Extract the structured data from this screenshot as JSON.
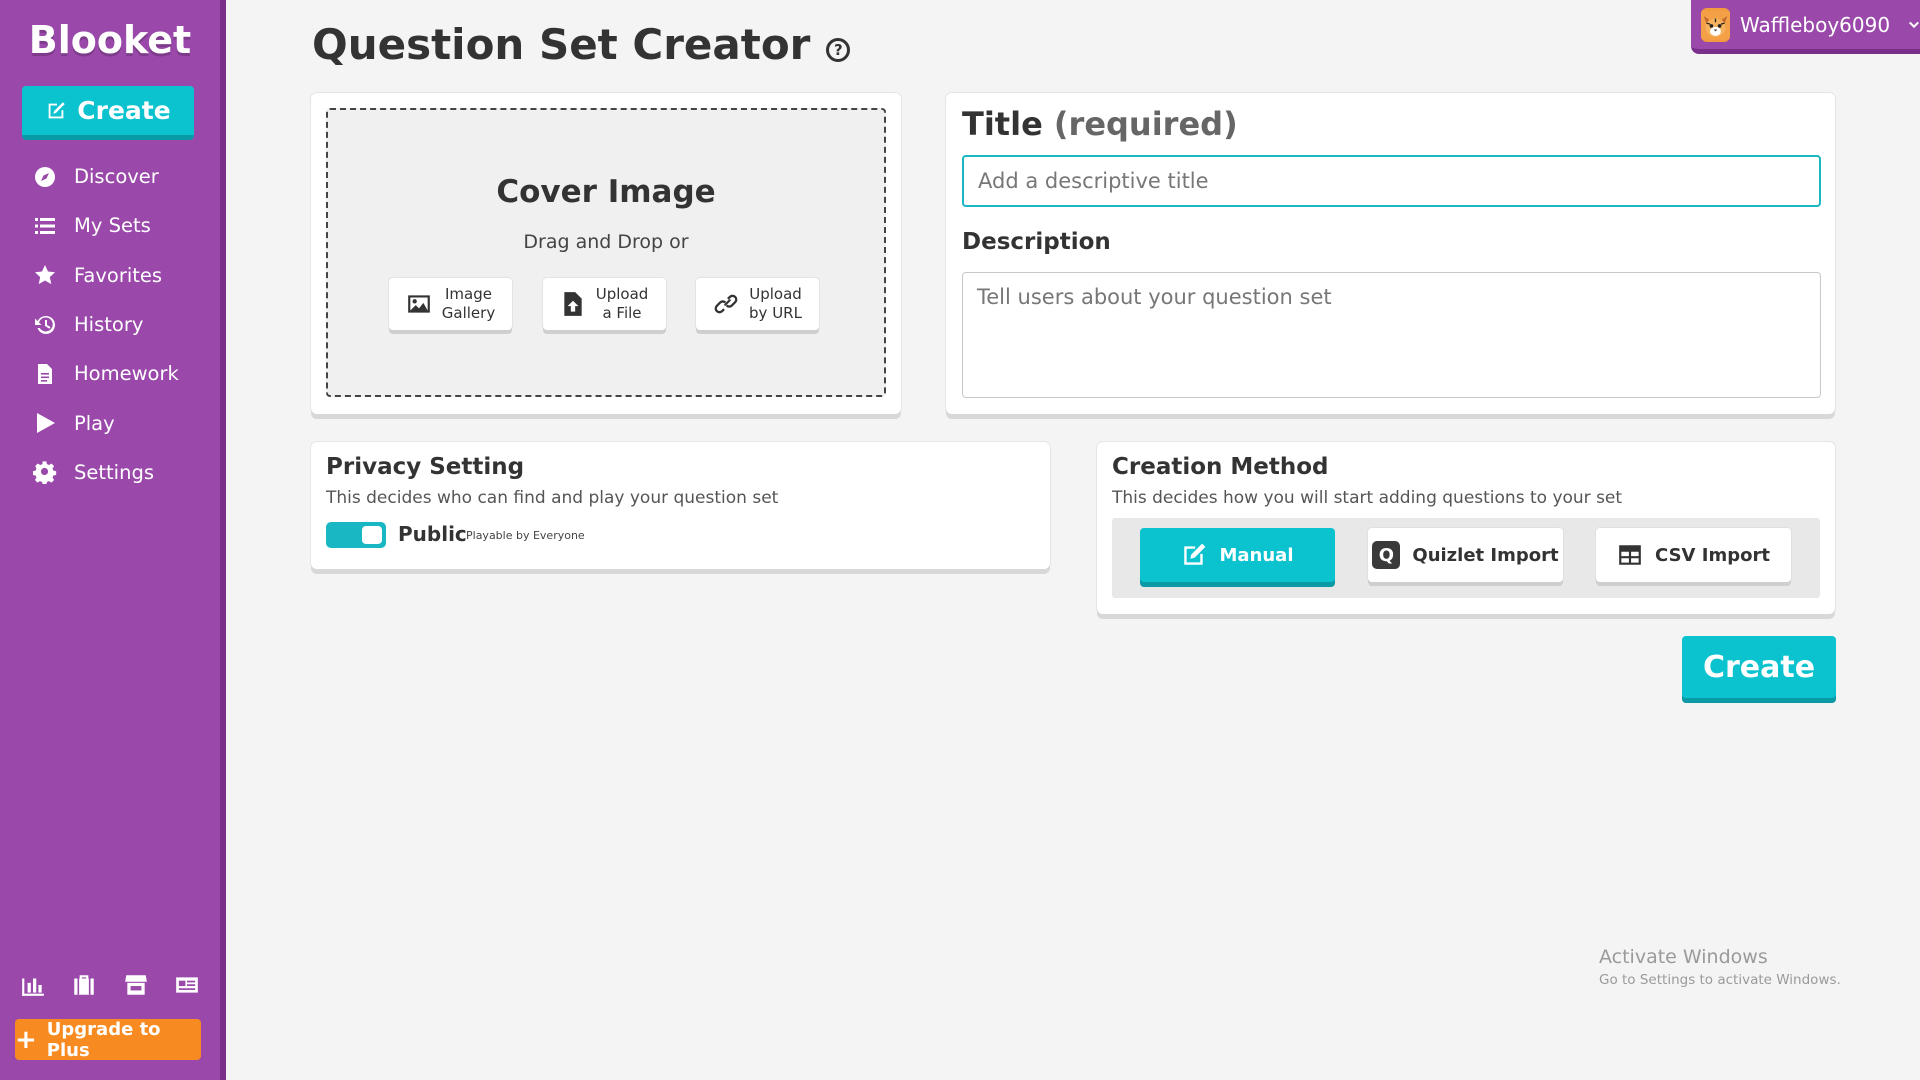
{
  "app": {
    "logo": "Blooket"
  },
  "sidebar": {
    "create_label": "Create",
    "items": [
      {
        "label": "Discover",
        "icon": "compass-icon"
      },
      {
        "label": "My Sets",
        "icon": "list-icon"
      },
      {
        "label": "Favorites",
        "icon": "star-icon"
      },
      {
        "label": "History",
        "icon": "history-icon"
      },
      {
        "label": "Homework",
        "icon": "document-icon"
      },
      {
        "label": "Play",
        "icon": "play-icon"
      },
      {
        "label": "Settings",
        "icon": "gear-icon"
      }
    ],
    "bottom_icons": [
      "stats-icon",
      "briefcase-icon",
      "store-icon",
      "news-icon"
    ],
    "upgrade_label": "Upgrade to Plus"
  },
  "header": {
    "title": "Question Set Creator",
    "help_icon": "?",
    "username": "Waffleboy6090"
  },
  "cover": {
    "title": "Cover Image",
    "subtitle": "Drag and Drop or",
    "buttons": [
      {
        "line1": "Image",
        "line2": "Gallery",
        "icon": "image-icon"
      },
      {
        "line1": "Upload",
        "line2": "a File",
        "icon": "file-upload-icon"
      },
      {
        "line1": "Upload",
        "line2": "by URL",
        "icon": "link-icon"
      }
    ]
  },
  "title_section": {
    "label": "Title",
    "required": "(required)",
    "placeholder": "Add a descriptive title",
    "value": ""
  },
  "description": {
    "label": "Description",
    "placeholder": "Tell users about your question set",
    "value": ""
  },
  "privacy": {
    "heading": "Privacy Setting",
    "desc": "This decides who can find and play your question set",
    "toggle_label": "Public",
    "toggle_sub": "Playable by Everyone",
    "enabled": true
  },
  "creation_method": {
    "heading": "Creation Method",
    "desc": "This decides how you will start adding questions to your set",
    "options": [
      {
        "label": "Manual",
        "selected": true
      },
      {
        "label": "Quizlet Import",
        "selected": false
      },
      {
        "label": "CSV Import",
        "selected": false
      }
    ],
    "quizlet_letter": "Q"
  },
  "actions": {
    "create_label": "Create"
  },
  "watermark": {
    "line1": "Activate Windows",
    "line2": "Go to Settings to activate Windows."
  },
  "colors": {
    "sidebar": "#9a49aa",
    "accent": "#0bc2cf",
    "upgrade": "#f78b22"
  }
}
